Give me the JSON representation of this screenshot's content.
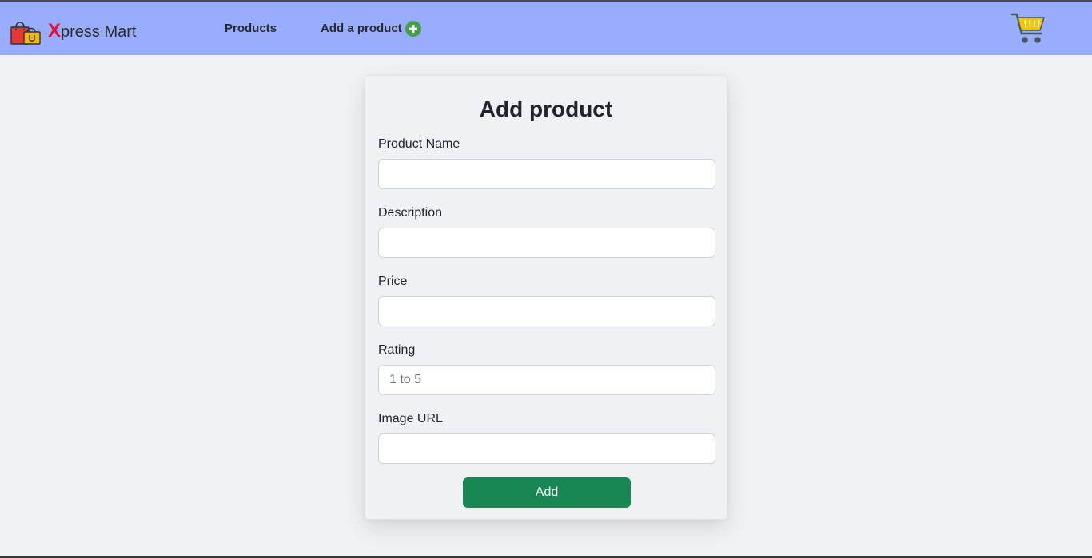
{
  "navbar": {
    "brand_initial": "X",
    "brand_rest": "press Mart",
    "links": [
      {
        "label": "Products"
      },
      {
        "label": "Add a product"
      }
    ],
    "accent_color": "#99adff"
  },
  "form": {
    "title": "Add product",
    "fields": [
      {
        "label": "Product Name",
        "value": "",
        "placeholder": ""
      },
      {
        "label": "Description",
        "value": "",
        "placeholder": ""
      },
      {
        "label": "Price",
        "value": "",
        "placeholder": ""
      },
      {
        "label": "Rating",
        "value": "",
        "placeholder": "1 to 5"
      },
      {
        "label": "Image URL",
        "value": "",
        "placeholder": ""
      }
    ],
    "submit_label": "Add",
    "submit_color": "#198754"
  },
  "icons": [
    "shopping-bags-logo-icon",
    "plus-circle-icon",
    "shopping-cart-icon"
  ]
}
